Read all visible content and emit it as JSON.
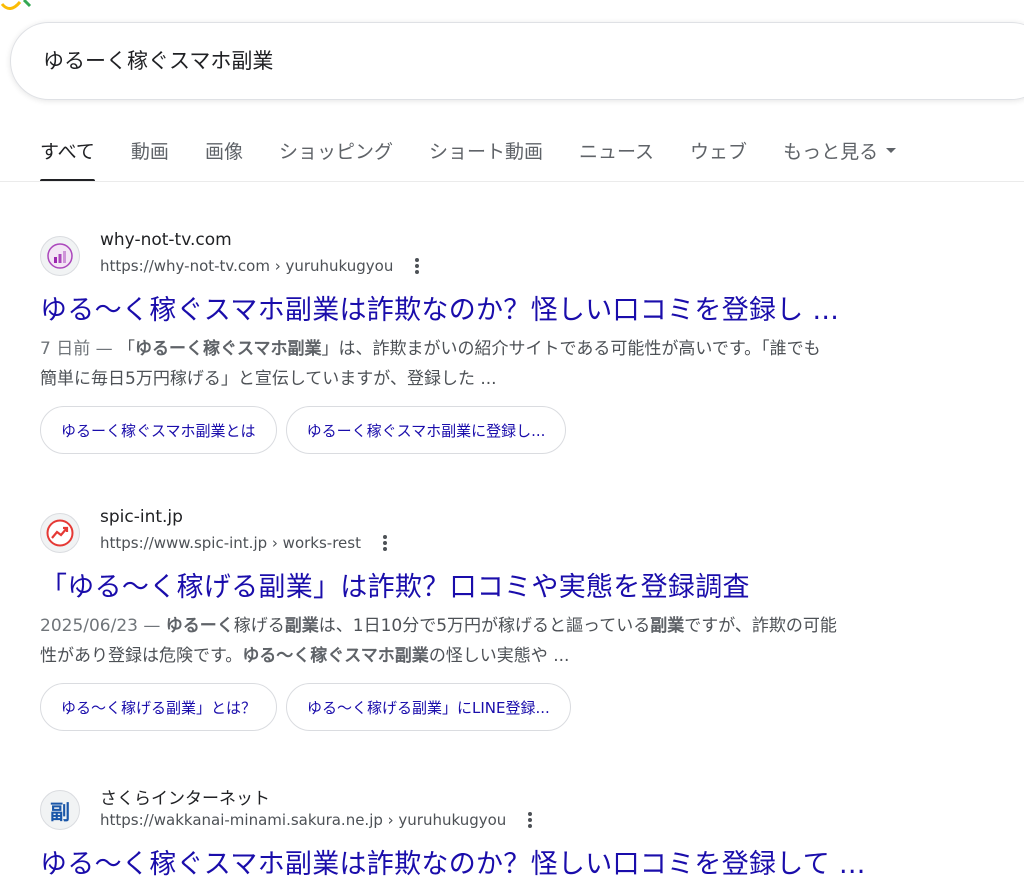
{
  "search": {
    "query": "ゆるーく稼ぐスマホ副業"
  },
  "tabs": [
    {
      "label": "すべて",
      "active": true
    },
    {
      "label": "動画"
    },
    {
      "label": "画像"
    },
    {
      "label": "ショッピング"
    },
    {
      "label": "ショート動画"
    },
    {
      "label": "ニュース"
    },
    {
      "label": "ウェブ"
    },
    {
      "label": "もっと見る",
      "dropdown": true
    }
  ],
  "results": [
    {
      "site_name": "why-not-tv.com",
      "url": "https://why-not-tv.com › yuruhukugyou",
      "title": "ゆる〜く稼ぐスマホ副業は詐欺なのか？怪しい口コミを登録し ...",
      "snippet": {
        "date": "7 日前 — ",
        "line1_pre": "「",
        "line1_bold": "ゆるーく稼ぐスマホ副業",
        "line1_post": "」は、詐欺まがいの紹介サイトである可能性が高いです。「誰でも",
        "line2": "簡単に毎日5万円稼げる」と宣伝していますが、登録した ..."
      },
      "chips": [
        "ゆるーく稼ぐスマホ副業とは",
        "ゆるーく稼ぐスマホ副業に登録し..."
      ],
      "favicon": "bar-chart-icon",
      "favicon_color": "#9c27b0"
    },
    {
      "site_name": "spic-int.jp",
      "url": "https://www.spic-int.jp › works-rest",
      "title": "「ゆる〜く稼げる副業」は詐欺？口コミや実態を登録調査",
      "snippet": {
        "date": "2025/06/23 — ",
        "line1_bold1": "ゆるーく",
        "line1_mid1": "稼げる",
        "line1_bold2": "副業",
        "line1_mid2": "は、1日10分で5万円が稼げると謳っている",
        "line1_bold3": "副業",
        "line1_post": "ですが、詐欺の可能",
        "line2_pre": "性があり登録は危険です。",
        "line2_bold": "ゆる〜く稼ぐスマホ副業",
        "line2_post": "の怪しい実態や ..."
      },
      "chips": [
        "ゆる〜く稼げる副業」とは？",
        "ゆる〜く稼げる副業」にLINE登録..."
      ],
      "favicon": "trend-up-icon",
      "favicon_color": "#e53935"
    },
    {
      "site_name": "さくらインターネット",
      "url": "https://wakkanai-minami.sakura.ne.jp › yuruhukugyou",
      "title": "ゆる〜く稼ぐスマホ副業は詐欺なのか？怪しい口コミを登録して ...",
      "favicon_text": "副",
      "favicon": "kanji-icon",
      "favicon_color": "#1a56a8"
    }
  ]
}
